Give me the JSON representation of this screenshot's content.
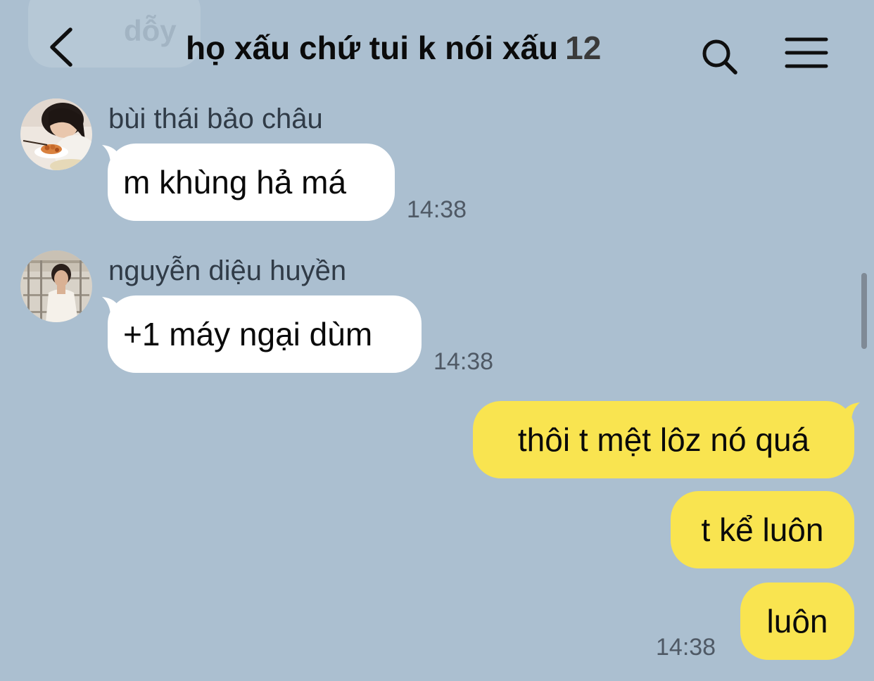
{
  "header": {
    "title": "họ xấu chứ tui k nói xấu",
    "member_count": "12",
    "back_icon": "chevron-left-icon",
    "search_icon": "search-icon",
    "menu_icon": "hamburger-menu-icon"
  },
  "background_preview": {
    "text": "dỗy"
  },
  "messages": [
    {
      "sender": "bùi thái bảo châu",
      "text": "m khùng hả má",
      "time": "14:38",
      "direction": "incoming"
    },
    {
      "sender": "nguyễn diệu huyền",
      "text": "+1 máy ngại dùm",
      "time": "14:38",
      "direction": "incoming"
    },
    {
      "text": "thôi t mệt lôz nó quá",
      "direction": "outgoing"
    },
    {
      "text": "t kể luôn",
      "direction": "outgoing"
    },
    {
      "text": "luôn",
      "time": "14:38",
      "direction": "outgoing"
    }
  ],
  "colors": {
    "background": "#abbfd0",
    "incoming_bubble": "#ffffff",
    "outgoing_bubble": "#f9e450",
    "time_text": "#4f5965",
    "sender_text": "#303b47"
  }
}
